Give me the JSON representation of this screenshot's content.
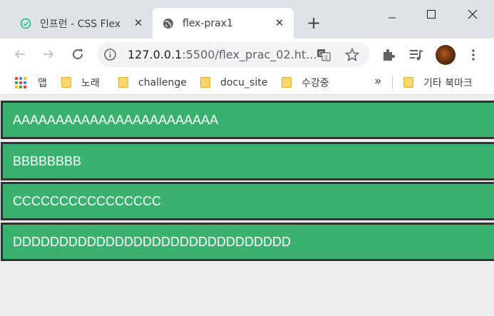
{
  "tabs": [
    {
      "title": "인프런 - CSS Flex",
      "icon": "inflearn-icon",
      "active": false
    },
    {
      "title": "flex-prax1",
      "icon": "globe-icon",
      "active": true
    }
  ],
  "address_bar": {
    "url_host": "127.0.0.1",
    "url_rest": ":5500/flex_prac_02.ht..."
  },
  "bookmarks": {
    "apps_label": "앱",
    "folders": [
      "노래",
      "challenge",
      "docu_site",
      "수강중"
    ],
    "overflow_label": "»",
    "other_label": "기타 북마크"
  },
  "flex_items": [
    "AAAAAAAAAAAAAAAAAAAAAAAA",
    "BBBBBBBB",
    "CCCCCCCCCCCCCCCC",
    "DDDDDDDDDDDDDDDDDDDDDDDDDDDDDD"
  ],
  "colors": {
    "item_background": "#3bb16f",
    "item_border": "#333333",
    "page_background": "#efefef"
  }
}
